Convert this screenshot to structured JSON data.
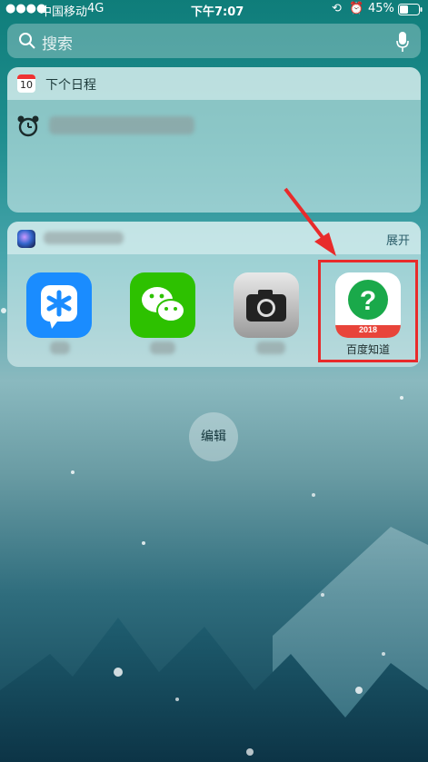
{
  "status_bar": {
    "carrier": "中国移动",
    "network": "4G",
    "time": "下午7:07",
    "battery": "45%"
  },
  "search": {
    "placeholder": "搜索"
  },
  "calendar_widget": {
    "icon_day": "10",
    "title": "下个日程"
  },
  "siri_widget": {
    "expand_label": "展开",
    "apps": [
      {
        "name": "qq-tim-app",
        "label": ""
      },
      {
        "name": "wechat-app",
        "label": ""
      },
      {
        "name": "camera-app",
        "label": ""
      },
      {
        "name": "baidu-zhidao-app",
        "label": "百度知道",
        "badge": "2018"
      }
    ]
  },
  "edit_button": {
    "label": "编辑"
  },
  "colors": {
    "highlight": "#e82b2b",
    "arrow": "#e82b2b",
    "zhidao_green": "#1aa94a",
    "wechat_green": "#2dc100",
    "tim_blue": "#1a8cff"
  }
}
